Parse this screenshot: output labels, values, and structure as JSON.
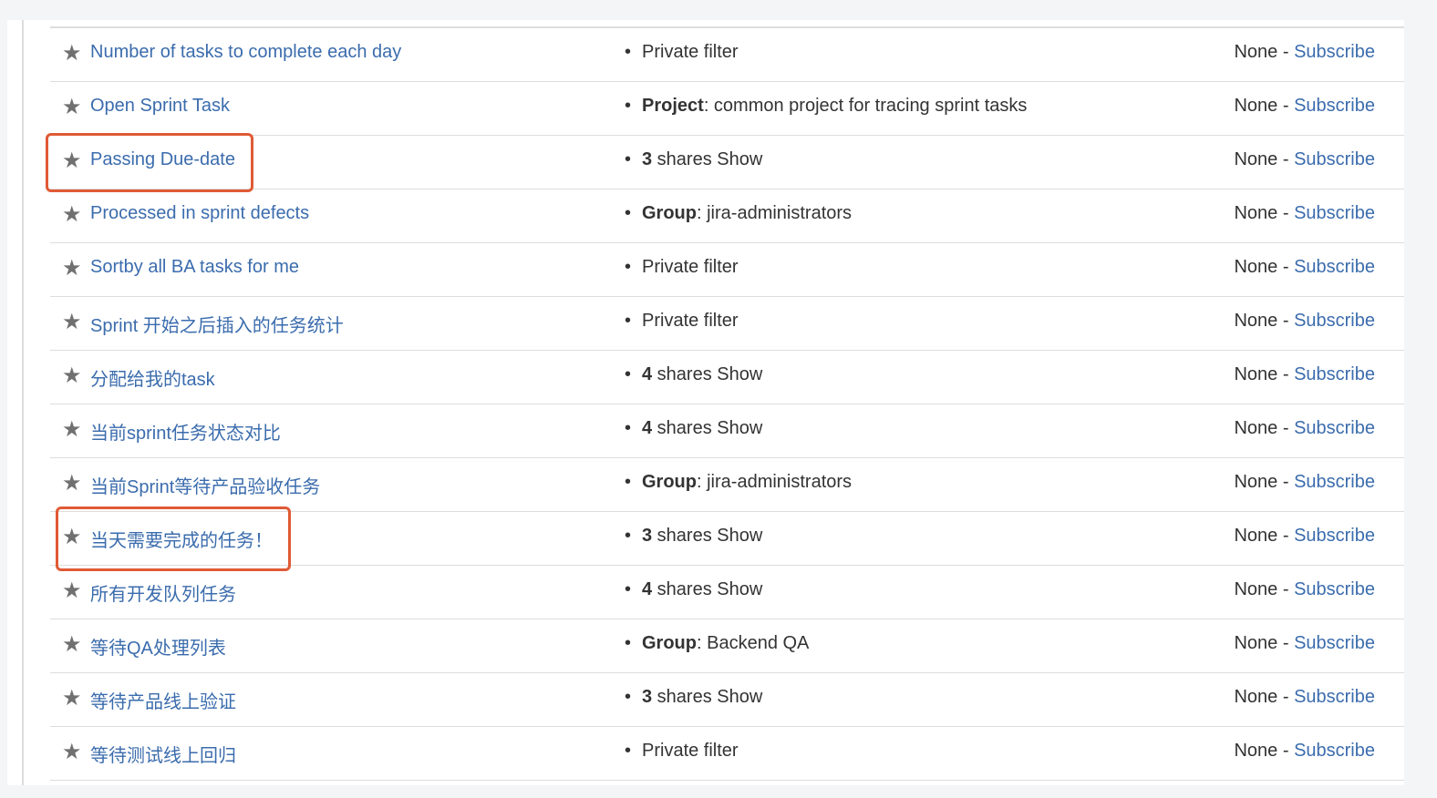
{
  "filters": [
    {
      "name": "Number of tasks to complete each day",
      "share_bold": "",
      "share_text": "Private filter"
    },
    {
      "name": "Open Sprint Task",
      "share_bold": "Project",
      "share_text": ": common project for tracing sprint tasks"
    },
    {
      "name": "Passing Due-date",
      "share_bold": "3",
      "share_text": " shares Show",
      "highlighted": true
    },
    {
      "name": "Processed in sprint defects",
      "share_bold": "Group",
      "share_text": ": jira-administrators"
    },
    {
      "name": "Sortby all BA tasks for me",
      "share_bold": "",
      "share_text": "Private filter"
    },
    {
      "name": "Sprint 开始之后插入的任务统计",
      "share_bold": "",
      "share_text": "Private filter"
    },
    {
      "name": "分配给我的task",
      "share_bold": "4",
      "share_text": " shares Show"
    },
    {
      "name": "当前sprint任务状态对比",
      "share_bold": "4",
      "share_text": " shares Show"
    },
    {
      "name": "当前Sprint等待产品验收任务",
      "share_bold": "Group",
      "share_text": ": jira-administrators"
    },
    {
      "name": "当天需要完成的任务！",
      "share_bold": "3",
      "share_text": " shares Show",
      "highlighted": true
    },
    {
      "name": "所有开发队列任务",
      "share_bold": "4",
      "share_text": " shares Show"
    },
    {
      "name": "等待QA处理列表",
      "share_bold": "Group",
      "share_text": ": Backend QA"
    },
    {
      "name": "等待产品线上验证",
      "share_bold": "3",
      "share_text": " shares Show"
    },
    {
      "name": "等待测试线上回归",
      "share_bold": "",
      "share_text": "Private filter"
    }
  ],
  "subscription": {
    "none_label": "None - ",
    "subscribe_label": "Subscribe"
  },
  "bullet": "•",
  "star_icon": "★",
  "colors": {
    "link": "#3b6cad",
    "highlight": "#e05a35",
    "star": "#707070"
  }
}
